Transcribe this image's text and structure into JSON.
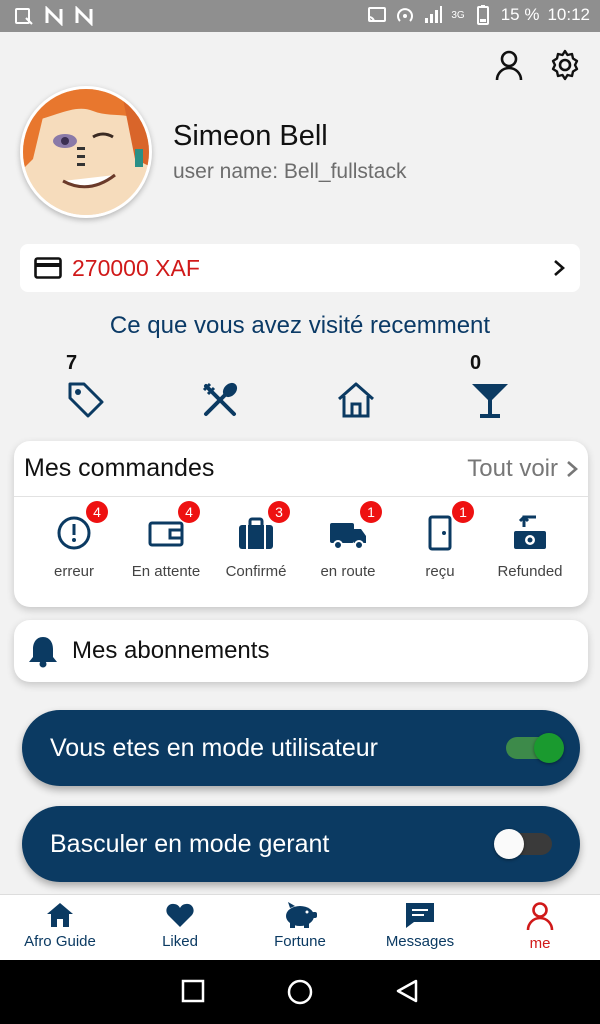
{
  "status_bar": {
    "battery": "15 %",
    "time": "10:12",
    "network": "3G"
  },
  "profile": {
    "name": "Simeon Bell",
    "username": "user name: Bell_fullstack"
  },
  "balance": {
    "value": "270000 XAF"
  },
  "visited": {
    "title": "Ce que vous avez visité recemment",
    "items": [
      {
        "icon": "tag-icon",
        "count": "7"
      },
      {
        "icon": "utensils-icon",
        "count": ""
      },
      {
        "icon": "home-icon",
        "count": ""
      },
      {
        "icon": "cocktail-icon",
        "count": "0"
      }
    ]
  },
  "orders": {
    "title": "Mes commandes",
    "view_all": "Tout voir",
    "items": [
      {
        "icon": "alert-circle-icon",
        "label": "erreur",
        "badge": "4"
      },
      {
        "icon": "wallet-icon",
        "label": "En attente",
        "badge": "4"
      },
      {
        "icon": "briefcase-icon",
        "label": "Confirmé",
        "badge": "3"
      },
      {
        "icon": "truck-icon",
        "label": "en route",
        "badge": "1"
      },
      {
        "icon": "door-icon",
        "label": "reçu",
        "badge": "1"
      },
      {
        "icon": "refund-icon",
        "label": "Refunded",
        "badge": ""
      }
    ]
  },
  "subscriptions": {
    "label": "Mes abonnements"
  },
  "modes": {
    "user_mode": {
      "label": "Vous etes  en mode utilisateur",
      "on": true
    },
    "manager_mode": {
      "label": "Basculer  en mode gerant",
      "on": false
    }
  },
  "bottom_nav": [
    {
      "label": "Afro Guide",
      "icon": "home-icon",
      "active": false
    },
    {
      "label": "Liked",
      "icon": "heart-icon",
      "active": false
    },
    {
      "label": "Fortune",
      "icon": "piggy-bank-icon",
      "active": false
    },
    {
      "label": "Messages",
      "icon": "message-icon",
      "active": false
    },
    {
      "label": "me",
      "icon": "user-icon",
      "active": true
    }
  ],
  "colors": {
    "primary": "#0b3a62",
    "accent_red": "#d01919",
    "switch_green": "#1a9a2f"
  }
}
